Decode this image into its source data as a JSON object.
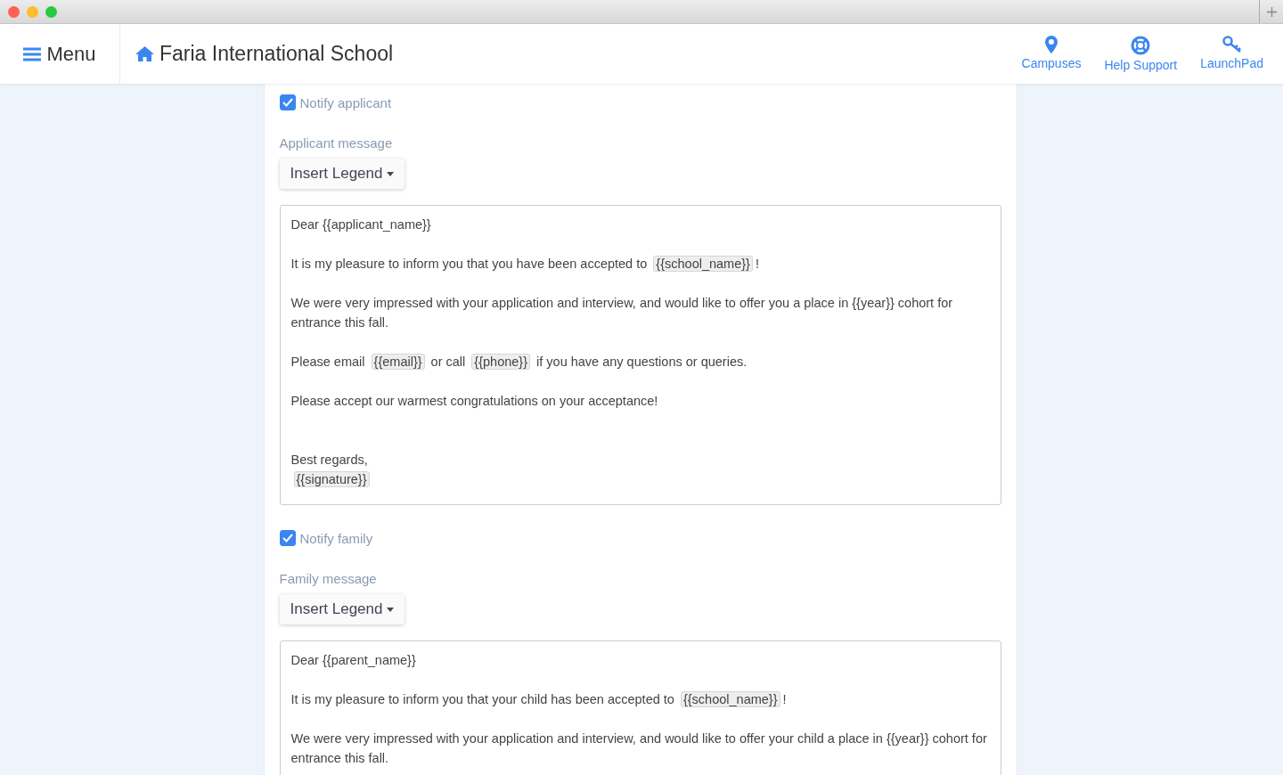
{
  "nav": {
    "menu_label": "Menu",
    "school_name": "Faria International School",
    "links": [
      {
        "kind": "pin",
        "label": "Campuses"
      },
      {
        "kind": "lifebuoy",
        "label": "Help Support"
      },
      {
        "kind": "key",
        "label": "LaunchPad"
      }
    ]
  },
  "sections": [
    {
      "notify": {
        "label": "Notify applicant",
        "checked": true
      },
      "message_label": "Applicant message",
      "legend_button": "Insert Legend",
      "paragraphs": [
        [
          [
            {
              "kind": "text",
              "text": "Dear {{applicant_name}}"
            }
          ]
        ],
        [
          [
            {
              "kind": "text",
              "text": "It is my pleasure to inform you that you have been accepted to "
            },
            {
              "kind": "token",
              "text": "{{school_name}}"
            },
            {
              "kind": "text",
              "text": "!"
            }
          ]
        ],
        [
          [
            {
              "kind": "text",
              "text": "We were very impressed with your application and interview, and would like to offer you a place in {{year}} cohort for entrance this fall."
            }
          ]
        ],
        [
          [
            {
              "kind": "text",
              "text": "Please email "
            },
            {
              "kind": "token",
              "text": "{{email}}"
            },
            {
              "kind": "text",
              "text": " or call "
            },
            {
              "kind": "token",
              "text": "{{phone}}"
            },
            {
              "kind": "text",
              "text": " if you have any questions or queries."
            }
          ]
        ],
        [
          [
            {
              "kind": "text",
              "text": "Please accept our warmest congratulations on your acceptance!"
            }
          ]
        ],
        [
          [
            {
              "kind": "text",
              "text": "Best regards,"
            }
          ],
          [
            {
              "kind": "token",
              "text": "{{signature}}"
            }
          ]
        ]
      ]
    },
    {
      "notify": {
        "label": "Notify family",
        "checked": true
      },
      "message_label": "Family message",
      "legend_button": "Insert Legend",
      "paragraphs": [
        [
          [
            {
              "kind": "text",
              "text": "Dear {{parent_name}}"
            }
          ]
        ],
        [
          [
            {
              "kind": "text",
              "text": "It is my pleasure to inform you that your child has been accepted to "
            },
            {
              "kind": "token",
              "text": "{{school_name}}"
            },
            {
              "kind": "text",
              "text": "!"
            }
          ]
        ],
        [
          [
            {
              "kind": "text",
              "text": "We were very impressed with your application and interview, and would like to offer your child a place in {{year}} cohort for entrance this fall."
            }
          ]
        ]
      ]
    }
  ]
}
